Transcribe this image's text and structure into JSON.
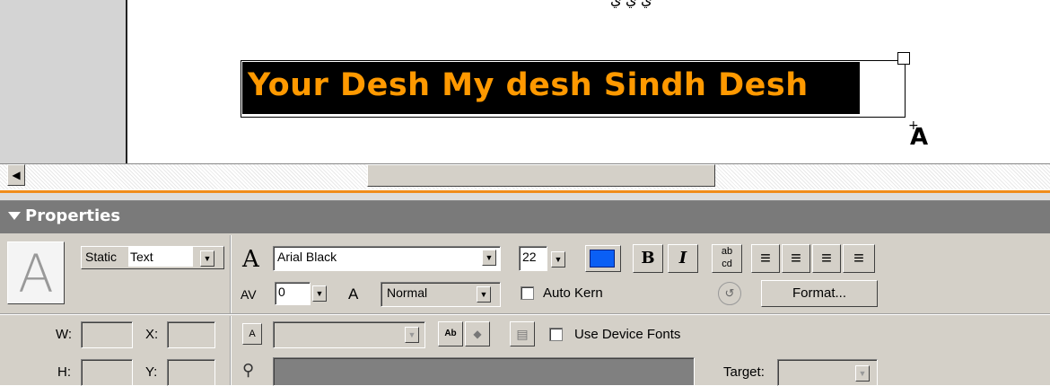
{
  "stage": {
    "text": "Your Desh My desh Sindh Desh",
    "text_color": "#ff9900",
    "box_color": "#000000",
    "cursor_glyph": "A",
    "cursor_plus": "+",
    "top_glyphs": "ي ي ي"
  },
  "properties": {
    "title": "Properties",
    "text_tool_icon": "A",
    "text_type_prefix": "Static",
    "text_type": "Text",
    "font_icon": "A",
    "font_name": "Arial Black",
    "font_size": "22",
    "color_swatch": "#0a5ff5",
    "bold_label": "B",
    "italic_label": "I",
    "tracking_icon": "AV",
    "tracking_value": "0",
    "baseline_icon": "A",
    "baseline_value": "Normal",
    "auto_kern_label": "Auto Kern",
    "format_button": "Format...",
    "w_label": "W:",
    "x_label": "X:",
    "h_label": "H:",
    "y_label": "Y:",
    "use_device_fonts_label": "Use Device Fonts",
    "target_label": "Target:"
  }
}
